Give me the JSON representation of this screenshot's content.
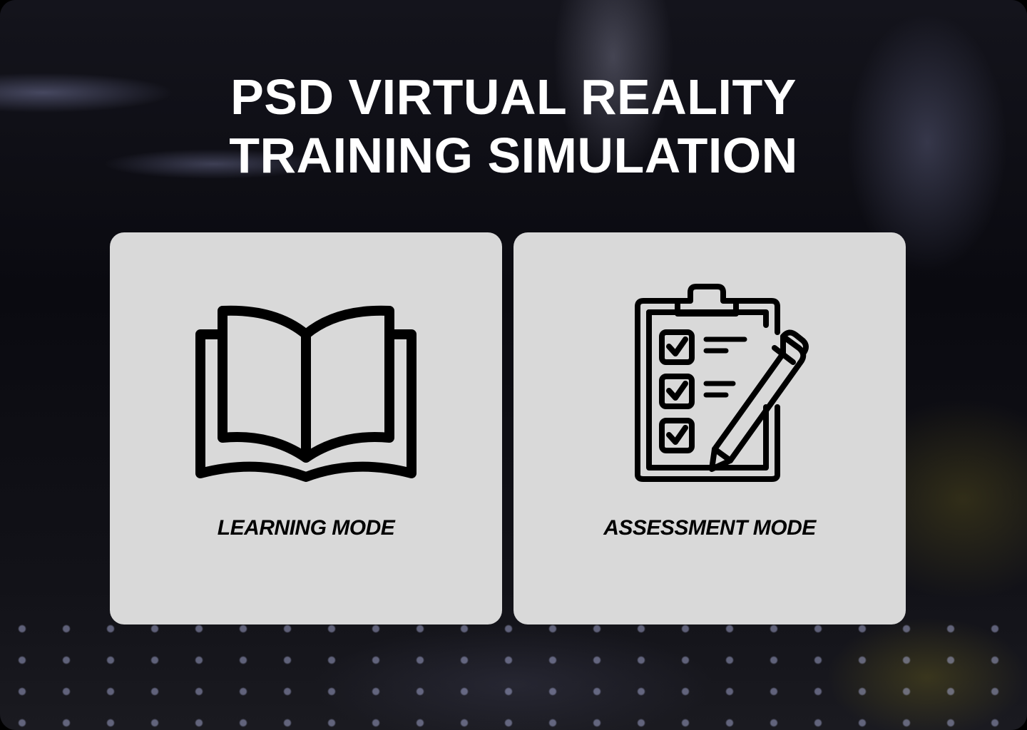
{
  "header": {
    "title_line1": "PSD VIRTUAL REALITY",
    "title_line2": "TRAINING SIMULATION"
  },
  "modes": [
    {
      "label": "LEARNING MODE",
      "icon": "open-book-icon"
    },
    {
      "label": "ASSESSMENT MODE",
      "icon": "clipboard-checklist-pencil-icon"
    }
  ],
  "colors": {
    "card_background": "#d9d9d9",
    "title_text": "#ffffff",
    "label_text": "#000000"
  }
}
